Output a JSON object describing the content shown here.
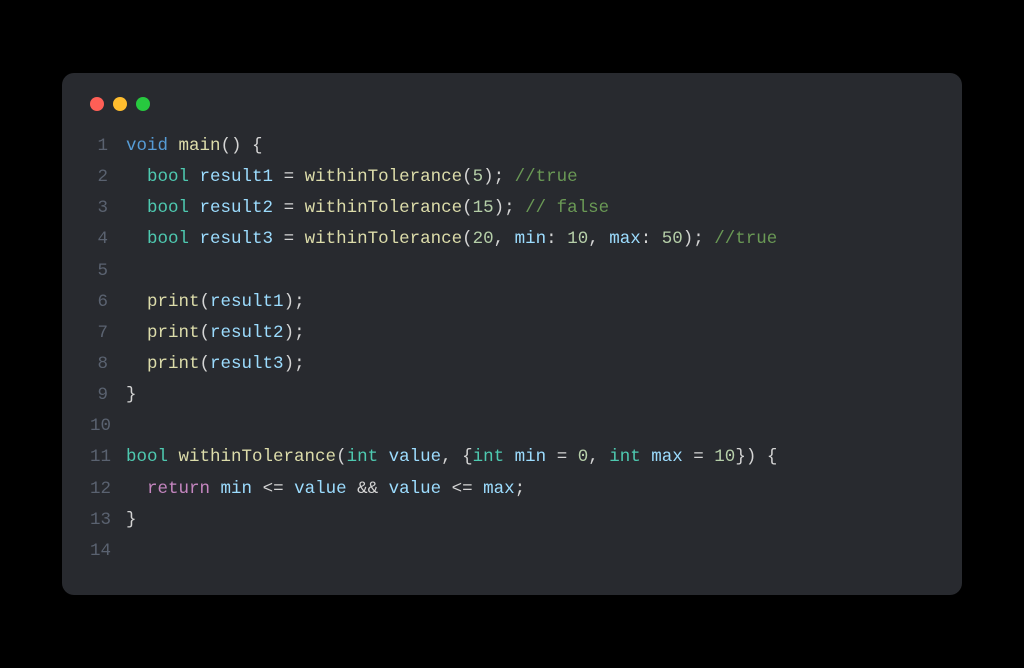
{
  "window": {
    "buttons": [
      "close",
      "minimize",
      "maximize"
    ]
  },
  "code": {
    "language": "dart",
    "lineNumbers": [
      "1",
      "2",
      "3",
      "4",
      "5",
      "6",
      "7",
      "8",
      "9",
      "10",
      "11",
      "12",
      "13",
      "14"
    ],
    "lines": [
      [
        {
          "t": "void",
          "c": "kw-void"
        },
        {
          "t": " ",
          "c": "punc"
        },
        {
          "t": "main",
          "c": "fn"
        },
        {
          "t": "() {",
          "c": "punc"
        }
      ],
      [
        {
          "t": "  ",
          "c": "punc"
        },
        {
          "t": "bool",
          "c": "kw-bool"
        },
        {
          "t": " ",
          "c": "punc"
        },
        {
          "t": "result1",
          "c": "var"
        },
        {
          "t": " = ",
          "c": "op"
        },
        {
          "t": "withinTolerance",
          "c": "fn"
        },
        {
          "t": "(",
          "c": "punc"
        },
        {
          "t": "5",
          "c": "num"
        },
        {
          "t": "); ",
          "c": "punc"
        },
        {
          "t": "//true",
          "c": "comment"
        }
      ],
      [
        {
          "t": "  ",
          "c": "punc"
        },
        {
          "t": "bool",
          "c": "kw-bool"
        },
        {
          "t": " ",
          "c": "punc"
        },
        {
          "t": "result2",
          "c": "var"
        },
        {
          "t": " = ",
          "c": "op"
        },
        {
          "t": "withinTolerance",
          "c": "fn"
        },
        {
          "t": "(",
          "c": "punc"
        },
        {
          "t": "15",
          "c": "num"
        },
        {
          "t": "); ",
          "c": "punc"
        },
        {
          "t": "// false",
          "c": "comment"
        }
      ],
      [
        {
          "t": "  ",
          "c": "punc"
        },
        {
          "t": "bool",
          "c": "kw-bool"
        },
        {
          "t": " ",
          "c": "punc"
        },
        {
          "t": "result3",
          "c": "var"
        },
        {
          "t": " = ",
          "c": "op"
        },
        {
          "t": "withinTolerance",
          "c": "fn"
        },
        {
          "t": "(",
          "c": "punc"
        },
        {
          "t": "20",
          "c": "num"
        },
        {
          "t": ", ",
          "c": "punc"
        },
        {
          "t": "min",
          "c": "param"
        },
        {
          "t": ": ",
          "c": "punc"
        },
        {
          "t": "10",
          "c": "num"
        },
        {
          "t": ", ",
          "c": "punc"
        },
        {
          "t": "max",
          "c": "param"
        },
        {
          "t": ": ",
          "c": "punc"
        },
        {
          "t": "50",
          "c": "num"
        },
        {
          "t": "); ",
          "c": "punc"
        },
        {
          "t": "//true",
          "c": "comment"
        }
      ],
      [],
      [
        {
          "t": "  ",
          "c": "punc"
        },
        {
          "t": "print",
          "c": "fn"
        },
        {
          "t": "(",
          "c": "punc"
        },
        {
          "t": "result1",
          "c": "var"
        },
        {
          "t": ");",
          "c": "punc"
        }
      ],
      [
        {
          "t": "  ",
          "c": "punc"
        },
        {
          "t": "print",
          "c": "fn"
        },
        {
          "t": "(",
          "c": "punc"
        },
        {
          "t": "result2",
          "c": "var"
        },
        {
          "t": ");",
          "c": "punc"
        }
      ],
      [
        {
          "t": "  ",
          "c": "punc"
        },
        {
          "t": "print",
          "c": "fn"
        },
        {
          "t": "(",
          "c": "punc"
        },
        {
          "t": "result3",
          "c": "var"
        },
        {
          "t": ");",
          "c": "punc"
        }
      ],
      [
        {
          "t": "}",
          "c": "punc"
        }
      ],
      [],
      [
        {
          "t": "bool",
          "c": "kw-bool"
        },
        {
          "t": " ",
          "c": "punc"
        },
        {
          "t": "withinTolerance",
          "c": "fn"
        },
        {
          "t": "(",
          "c": "punc"
        },
        {
          "t": "int",
          "c": "kw-int"
        },
        {
          "t": " ",
          "c": "punc"
        },
        {
          "t": "value",
          "c": "param"
        },
        {
          "t": ", {",
          "c": "punc"
        },
        {
          "t": "int",
          "c": "kw-int"
        },
        {
          "t": " ",
          "c": "punc"
        },
        {
          "t": "min",
          "c": "param"
        },
        {
          "t": " = ",
          "c": "op"
        },
        {
          "t": "0",
          "c": "num"
        },
        {
          "t": ", ",
          "c": "punc"
        },
        {
          "t": "int",
          "c": "kw-int"
        },
        {
          "t": " ",
          "c": "punc"
        },
        {
          "t": "max",
          "c": "param"
        },
        {
          "t": " = ",
          "c": "op"
        },
        {
          "t": "10",
          "c": "num"
        },
        {
          "t": "}) {",
          "c": "punc"
        }
      ],
      [
        {
          "t": "  ",
          "c": "punc"
        },
        {
          "t": "return",
          "c": "kw-return"
        },
        {
          "t": " ",
          "c": "punc"
        },
        {
          "t": "min",
          "c": "var"
        },
        {
          "t": " <= ",
          "c": "op"
        },
        {
          "t": "value",
          "c": "var"
        },
        {
          "t": " && ",
          "c": "op"
        },
        {
          "t": "value",
          "c": "var"
        },
        {
          "t": " <= ",
          "c": "op"
        },
        {
          "t": "max",
          "c": "var"
        },
        {
          "t": ";",
          "c": "punc"
        }
      ],
      [
        {
          "t": "}",
          "c": "punc"
        }
      ],
      []
    ]
  }
}
